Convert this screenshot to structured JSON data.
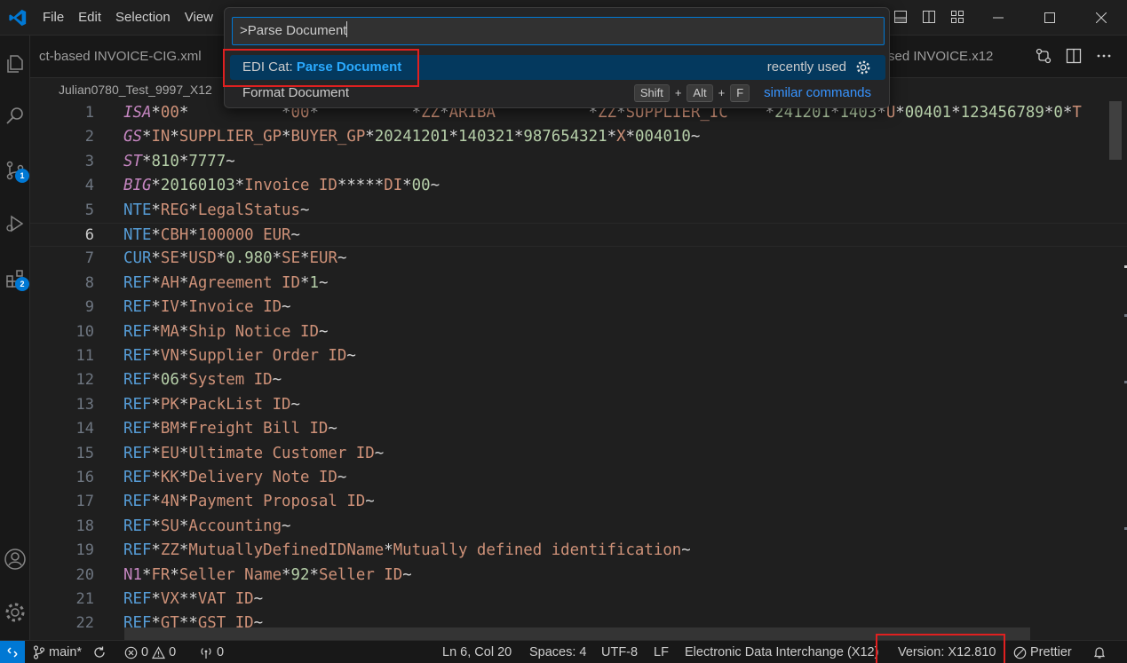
{
  "colors": {
    "accent": "#0078d4",
    "highlight": "#2aaaff",
    "annotation": "#e02020"
  },
  "menu": [
    "File",
    "Edit",
    "Selection",
    "View"
  ],
  "tabs": {
    "left_partial": "ct-based INVOICE-CIG.xml",
    "right_partial": "sed INVOICE.x12"
  },
  "breadcrumb": "Julian0780_Test_9997_X12",
  "activity_badges": {
    "source_control": "1",
    "extensions": "2"
  },
  "palette": {
    "query": ">Parse Document",
    "items": [
      {
        "prefix": "EDI Cat: ",
        "match": "Parse Document",
        "detail": "recently used"
      },
      {
        "label": "Format Document",
        "keys": [
          "Shift",
          "Alt",
          "F"
        ],
        "plus": "+",
        "link": "similar commands"
      }
    ]
  },
  "editor": {
    "current_line": 6,
    "lines": [
      [
        [
          "seg it",
          "ISA"
        ],
        [
          "del",
          "*"
        ],
        [
          "el",
          "00"
        ],
        [
          "del",
          "*"
        ],
        [
          "el",
          "          "
        ],
        [
          "del",
          "*"
        ],
        [
          "el",
          "00"
        ],
        [
          "del",
          "*"
        ],
        [
          "el",
          "          "
        ],
        [
          "del",
          "*"
        ],
        [
          "el",
          "ZZ"
        ],
        [
          "del",
          "*"
        ],
        [
          "el",
          "ARIBA          "
        ],
        [
          "del",
          "*"
        ],
        [
          "el",
          "ZZ"
        ],
        [
          "del",
          "*"
        ],
        [
          "el",
          "SUPPLIER_IC    "
        ],
        [
          "del",
          "*"
        ],
        [
          "num",
          "241201"
        ],
        [
          "del",
          "*"
        ],
        [
          "num",
          "1403"
        ],
        [
          "del",
          "*"
        ],
        [
          "el",
          "U"
        ],
        [
          "del",
          "*"
        ],
        [
          "num",
          "00401"
        ],
        [
          "del",
          "*"
        ],
        [
          "num",
          "123456789"
        ],
        [
          "del",
          "*"
        ],
        [
          "num",
          "0"
        ],
        [
          "del",
          "*"
        ],
        [
          "el",
          "T"
        ]
      ],
      [
        [
          "seg it",
          "GS"
        ],
        [
          "del",
          "*"
        ],
        [
          "el",
          "IN"
        ],
        [
          "del",
          "*"
        ],
        [
          "el",
          "SUPPLIER_GP"
        ],
        [
          "del",
          "*"
        ],
        [
          "el",
          "BUYER_GP"
        ],
        [
          "del",
          "*"
        ],
        [
          "num",
          "20241201"
        ],
        [
          "del",
          "*"
        ],
        [
          "num",
          "140321"
        ],
        [
          "del",
          "*"
        ],
        [
          "num",
          "987654321"
        ],
        [
          "del",
          "*"
        ],
        [
          "el",
          "X"
        ],
        [
          "del",
          "*"
        ],
        [
          "num",
          "004010"
        ],
        [
          "term",
          "~"
        ]
      ],
      [
        [
          "seg it",
          "ST"
        ],
        [
          "del",
          "*"
        ],
        [
          "num",
          "810"
        ],
        [
          "del",
          "*"
        ],
        [
          "num",
          "7777"
        ],
        [
          "term",
          "~"
        ]
      ],
      [
        [
          "seg it",
          "BIG"
        ],
        [
          "del",
          "*"
        ],
        [
          "num",
          "20160103"
        ],
        [
          "del",
          "*"
        ],
        [
          "el",
          "Invoice ID"
        ],
        [
          "del",
          "*****"
        ],
        [
          "el",
          "DI"
        ],
        [
          "del",
          "*"
        ],
        [
          "num",
          "00"
        ],
        [
          "term",
          "~"
        ]
      ],
      [
        [
          "seg",
          "NTE"
        ],
        [
          "del",
          "*"
        ],
        [
          "el",
          "REG"
        ],
        [
          "del",
          "*"
        ],
        [
          "el",
          "LegalStatus"
        ],
        [
          "term",
          "~"
        ]
      ],
      [
        [
          "seg",
          "NTE"
        ],
        [
          "del",
          "*"
        ],
        [
          "el",
          "CBH"
        ],
        [
          "del",
          "*"
        ],
        [
          "el",
          "100000 EUR"
        ],
        [
          "term",
          "~"
        ]
      ],
      [
        [
          "seg",
          "CUR"
        ],
        [
          "del",
          "*"
        ],
        [
          "el",
          "SE"
        ],
        [
          "del",
          "*"
        ],
        [
          "el",
          "USD"
        ],
        [
          "del",
          "*"
        ],
        [
          "num",
          "0.980"
        ],
        [
          "del",
          "*"
        ],
        [
          "el",
          "SE"
        ],
        [
          "del",
          "*"
        ],
        [
          "el",
          "EUR"
        ],
        [
          "term",
          "~"
        ]
      ],
      [
        [
          "seg",
          "REF"
        ],
        [
          "del",
          "*"
        ],
        [
          "el",
          "AH"
        ],
        [
          "del",
          "*"
        ],
        [
          "el",
          "Agreement ID"
        ],
        [
          "del",
          "*"
        ],
        [
          "num",
          "1"
        ],
        [
          "term",
          "~"
        ]
      ],
      [
        [
          "seg",
          "REF"
        ],
        [
          "del",
          "*"
        ],
        [
          "el",
          "IV"
        ],
        [
          "del",
          "*"
        ],
        [
          "el",
          "Invoice ID"
        ],
        [
          "term",
          "~"
        ]
      ],
      [
        [
          "seg",
          "REF"
        ],
        [
          "del",
          "*"
        ],
        [
          "el",
          "MA"
        ],
        [
          "del",
          "*"
        ],
        [
          "el",
          "Ship Notice ID"
        ],
        [
          "term",
          "~"
        ]
      ],
      [
        [
          "seg",
          "REF"
        ],
        [
          "del",
          "*"
        ],
        [
          "el",
          "VN"
        ],
        [
          "del",
          "*"
        ],
        [
          "el",
          "Supplier Order ID"
        ],
        [
          "term",
          "~"
        ]
      ],
      [
        [
          "seg",
          "REF"
        ],
        [
          "del",
          "*"
        ],
        [
          "num",
          "06"
        ],
        [
          "del",
          "*"
        ],
        [
          "el",
          "System ID"
        ],
        [
          "term",
          "~"
        ]
      ],
      [
        [
          "seg",
          "REF"
        ],
        [
          "del",
          "*"
        ],
        [
          "el",
          "PK"
        ],
        [
          "del",
          "*"
        ],
        [
          "el",
          "PackList ID"
        ],
        [
          "term",
          "~"
        ]
      ],
      [
        [
          "seg",
          "REF"
        ],
        [
          "del",
          "*"
        ],
        [
          "el",
          "BM"
        ],
        [
          "del",
          "*"
        ],
        [
          "el",
          "Freight Bill ID"
        ],
        [
          "term",
          "~"
        ]
      ],
      [
        [
          "seg",
          "REF"
        ],
        [
          "del",
          "*"
        ],
        [
          "el",
          "EU"
        ],
        [
          "del",
          "*"
        ],
        [
          "el",
          "Ultimate Customer ID"
        ],
        [
          "term",
          "~"
        ]
      ],
      [
        [
          "seg",
          "REF"
        ],
        [
          "del",
          "*"
        ],
        [
          "el",
          "KK"
        ],
        [
          "del",
          "*"
        ],
        [
          "el",
          "Delivery Note ID"
        ],
        [
          "term",
          "~"
        ]
      ],
      [
        [
          "seg",
          "REF"
        ],
        [
          "del",
          "*"
        ],
        [
          "el",
          "4N"
        ],
        [
          "del",
          "*"
        ],
        [
          "el",
          "Payment Proposal ID"
        ],
        [
          "term",
          "~"
        ]
      ],
      [
        [
          "seg",
          "REF"
        ],
        [
          "del",
          "*"
        ],
        [
          "el",
          "SU"
        ],
        [
          "del",
          "*"
        ],
        [
          "el",
          "Accounting"
        ],
        [
          "term",
          "~"
        ]
      ],
      [
        [
          "seg",
          "REF"
        ],
        [
          "del",
          "*"
        ],
        [
          "el",
          "ZZ"
        ],
        [
          "del",
          "*"
        ],
        [
          "el",
          "MutuallyDefinedIDName"
        ],
        [
          "del",
          "*"
        ],
        [
          "el",
          "Mutually defined identification"
        ],
        [
          "term",
          "~"
        ]
      ],
      [
        [
          "seg n1",
          "N1"
        ],
        [
          "del",
          "*"
        ],
        [
          "el",
          "FR"
        ],
        [
          "del",
          "*"
        ],
        [
          "el",
          "Seller Name"
        ],
        [
          "del",
          "*"
        ],
        [
          "num",
          "92"
        ],
        [
          "del",
          "*"
        ],
        [
          "el",
          "Seller ID"
        ],
        [
          "term",
          "~"
        ]
      ],
      [
        [
          "seg",
          "REF"
        ],
        [
          "del",
          "*"
        ],
        [
          "el",
          "VX"
        ],
        [
          "del",
          "**"
        ],
        [
          "el",
          "VAT ID"
        ],
        [
          "term",
          "~"
        ]
      ],
      [
        [
          "seg",
          "REF"
        ],
        [
          "del",
          "*"
        ],
        [
          "el",
          "GT"
        ],
        [
          "del",
          "**"
        ],
        [
          "el",
          "GST ID"
        ],
        [
          "term",
          "~"
        ]
      ]
    ]
  },
  "status": {
    "branch": "main*",
    "errors": "0",
    "warnings": "0",
    "ports": "0",
    "position": "Ln 6, Col 20",
    "spaces": "Spaces: 4",
    "encoding": "UTF-8",
    "eol": "LF",
    "language": "Electronic Data Interchange (X12)",
    "version": "Version: X12.810",
    "prettier": "Prettier"
  }
}
